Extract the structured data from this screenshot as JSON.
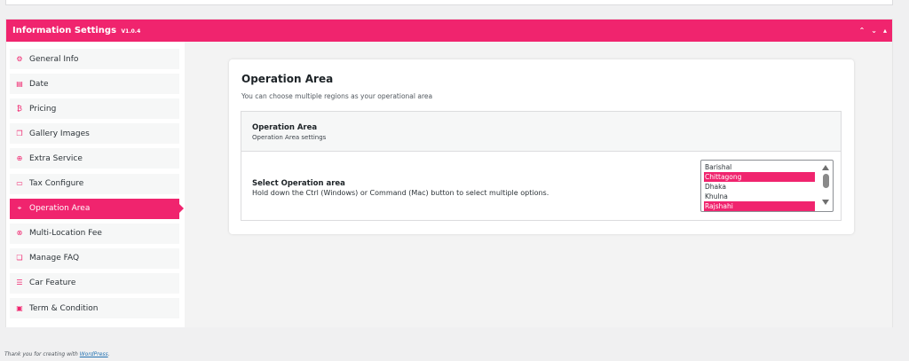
{
  "header": {
    "title": "Information Settings",
    "version": "V1.0.4",
    "controls": [
      "⌃",
      "⌄",
      "▴"
    ]
  },
  "colors": {
    "accent": "#f0246e",
    "background": "#f0f0f1",
    "link": "#2271b1"
  },
  "sidebar": {
    "items": [
      {
        "label": "General Info",
        "icon": "gear-icon",
        "glyph": "⚙",
        "active": false
      },
      {
        "label": "Date",
        "icon": "calendar-icon",
        "glyph": "▤",
        "active": false
      },
      {
        "label": "Pricing",
        "icon": "money-icon",
        "glyph": "₿",
        "active": false
      },
      {
        "label": "Gallery Images",
        "icon": "images-icon",
        "glyph": "❐",
        "active": false
      },
      {
        "label": "Extra Service",
        "icon": "service-icon",
        "glyph": "⊕",
        "active": false
      },
      {
        "label": "Tax Configure",
        "icon": "tax-icon",
        "glyph": "▭",
        "active": false
      },
      {
        "label": "Operation Area",
        "icon": "map-icon",
        "glyph": "⌖",
        "active": true
      },
      {
        "label": "Multi-Location Fee",
        "icon": "location-fee-icon",
        "glyph": "⊗",
        "active": false
      },
      {
        "label": "Manage FAQ",
        "icon": "faq-icon",
        "glyph": "❏",
        "active": false
      },
      {
        "label": "Car Feature",
        "icon": "list-icon",
        "glyph": "☰",
        "active": false
      },
      {
        "label": "Term & Condition",
        "icon": "document-icon",
        "glyph": "▣",
        "active": false
      }
    ]
  },
  "main": {
    "title": "Operation Area",
    "description": "You can choose multiple regions as your operational area",
    "section": {
      "title": "Operation Area",
      "subtitle": "Operation Area settings",
      "field": {
        "label": "Select Operation area",
        "help": "Hold down the Ctrl (Windows) or Command (Mac) button to select multiple options.",
        "options": [
          {
            "label": "Barishal",
            "selected": false
          },
          {
            "label": "Chittagong",
            "selected": true
          },
          {
            "label": "Dhaka",
            "selected": false
          },
          {
            "label": "Khulna",
            "selected": false
          },
          {
            "label": "Rajshahi",
            "selected": true
          }
        ]
      }
    }
  },
  "footer": {
    "prefix": "Thank you for creating with ",
    "link_text": "WordPress",
    "suffix": "."
  }
}
